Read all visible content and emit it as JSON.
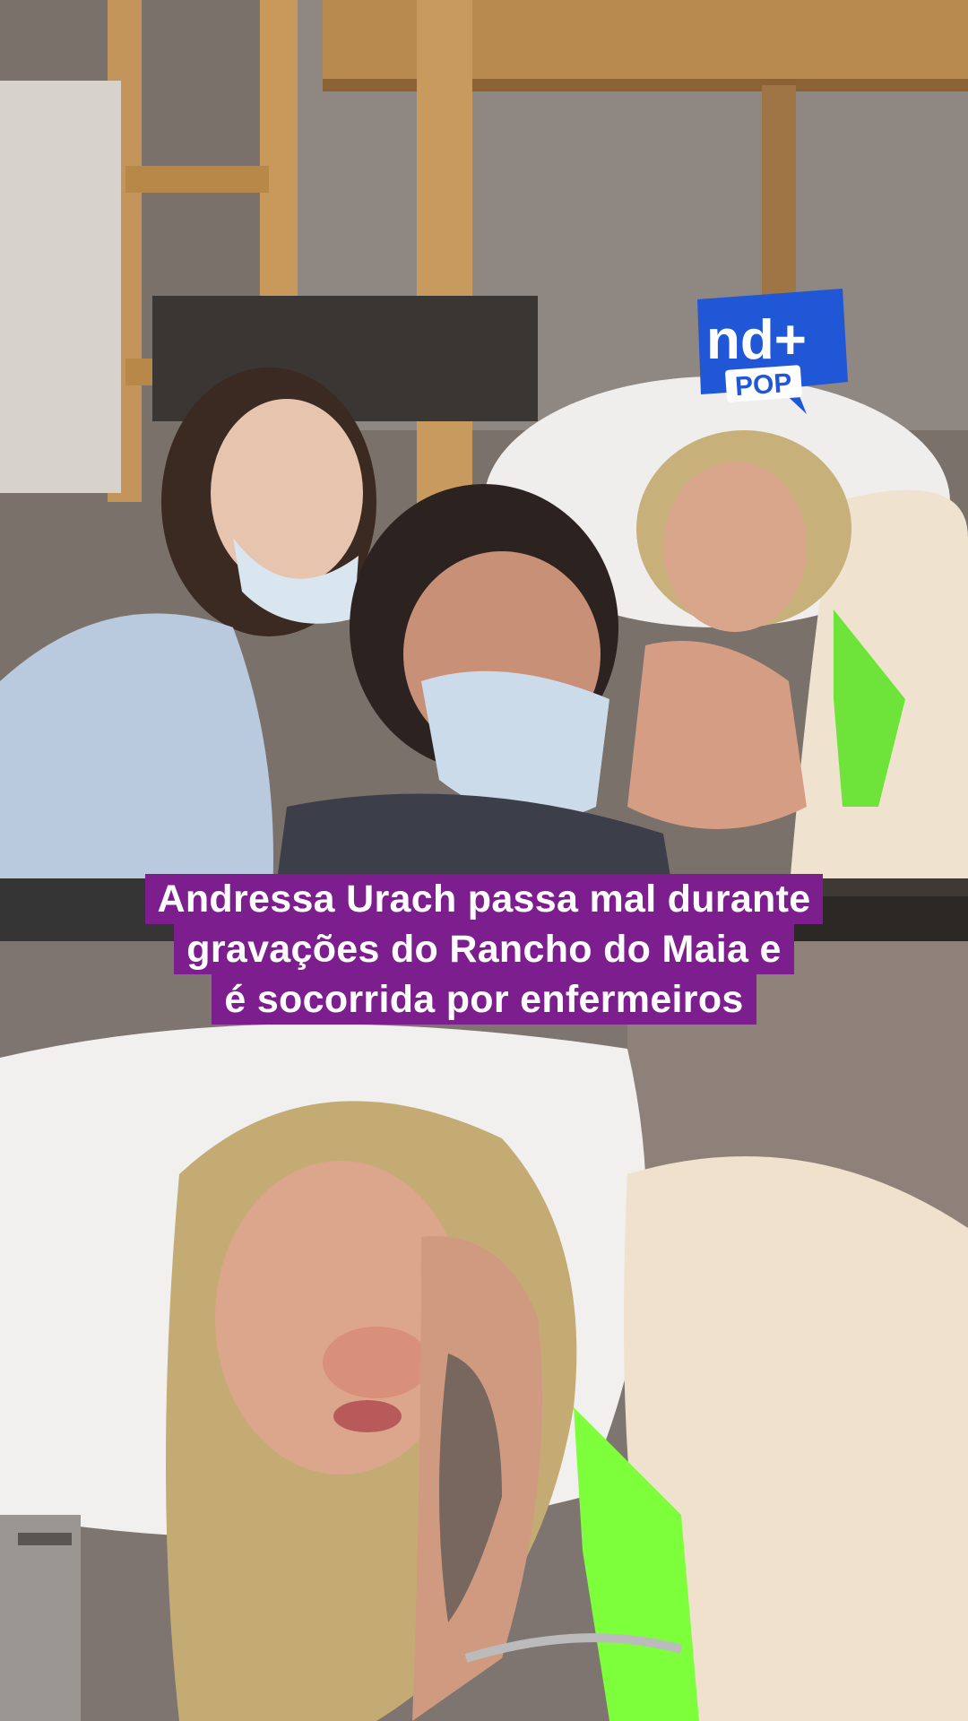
{
  "brand": {
    "logo_main": "nd+",
    "logo_sub": "POP",
    "colors": {
      "logo_blue": "#1f57d6",
      "logo_white": "#ffffff",
      "headline_background": "#7d1e8f",
      "headline_text": "#ffffff"
    }
  },
  "headline": {
    "lines": [
      "Andressa Urach passa mal durante",
      "gravações do Rancho do Maia e",
      "é socorrida por enfermeiros"
    ]
  },
  "media": {
    "top_photo_icon": "photo-scene",
    "bottom_photo_icon": "photo-closeup"
  }
}
